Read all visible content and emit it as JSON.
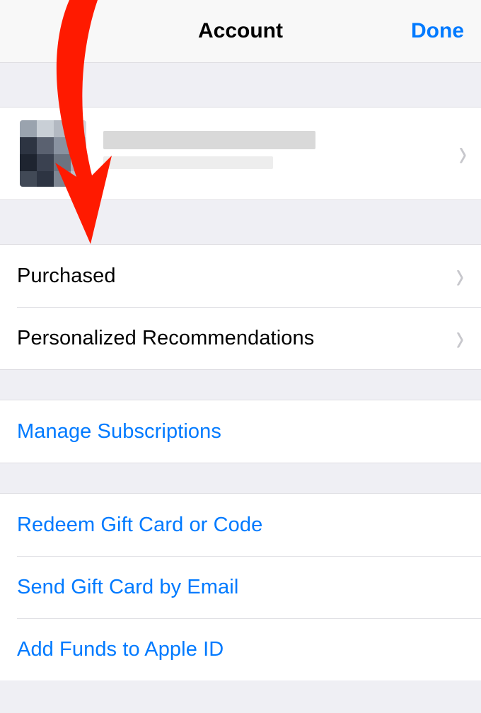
{
  "header": {
    "title": "Account",
    "done_label": "Done"
  },
  "profile": {
    "name_redacted": true
  },
  "section1": {
    "items": [
      {
        "label": "Purchased"
      },
      {
        "label": "Personalized Recommendations"
      }
    ]
  },
  "section2": {
    "items": [
      {
        "label": "Manage Subscriptions"
      }
    ]
  },
  "section3": {
    "items": [
      {
        "label": "Redeem Gift Card or Code"
      },
      {
        "label": "Send Gift Card by Email"
      },
      {
        "label": "Add Funds to Apple ID"
      }
    ]
  },
  "annotation": {
    "arrow_color": "#ff1a00",
    "arrow_target": "Purchased"
  }
}
